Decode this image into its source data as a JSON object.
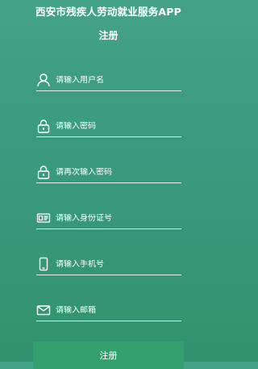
{
  "header": {
    "title": "西安市残疾人劳动就业服务APP",
    "subtitle": "注册"
  },
  "form": {
    "fields": [
      {
        "icon": "user-icon",
        "placeholder": "请输入用户名",
        "value": ""
      },
      {
        "icon": "lock-icon",
        "placeholder": "请输入密码",
        "value": ""
      },
      {
        "icon": "lock-icon",
        "placeholder": "请再次输入密码",
        "value": ""
      },
      {
        "icon": "id-card-icon",
        "placeholder": "请输入身份证号",
        "value": ""
      },
      {
        "icon": "phone-icon",
        "placeholder": "请输入手机号",
        "value": ""
      },
      {
        "icon": "mail-icon",
        "placeholder": "请输入邮箱",
        "value": ""
      }
    ],
    "submit_label": "注册"
  },
  "colors": {
    "background_top": "#43a287",
    "background_bottom": "#31926f",
    "button": "#35a06f",
    "text": "#ffffff"
  }
}
